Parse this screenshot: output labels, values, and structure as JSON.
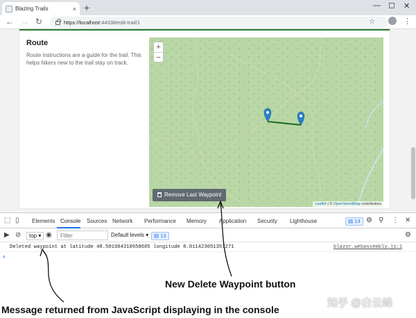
{
  "browser": {
    "tab_title": "Blazing Trails",
    "tab_close": "×",
    "new_tab": "+",
    "url_host": "https://localhost",
    "url_path": ":44338/edit-trail/1",
    "window_controls": {
      "minimize": "—",
      "maximize": "☐",
      "close": "✕"
    },
    "nav": {
      "back": "←",
      "forward": "→",
      "reload": "↻"
    }
  },
  "page": {
    "section_title": "Route",
    "section_description": "Route instructions are a guide for the trail. This helps hikers new to the trail stay on track.",
    "map": {
      "zoom_in": "+",
      "zoom_out": "−",
      "remove_button": "Remove Last Waypoint",
      "attribution_leaflet": "Leaflet",
      "attribution_sep": " | © ",
      "attribution_osm": "OpenStreetMap",
      "attribution_suffix": " contributors",
      "colors": {
        "map_bg": "#b9d7a6",
        "route_line": "#1b6b20",
        "marker": "#2a81cb",
        "button": "#606a70"
      },
      "icons": [
        "zoom-in-icon",
        "zoom-out-icon",
        "map-marker-icon",
        "trash-icon"
      ]
    }
  },
  "devtools": {
    "tabs": [
      "Elements",
      "Console",
      "Sources",
      "Network",
      "Performance",
      "Memory",
      "Application",
      "Security",
      "Lighthouse"
    ],
    "active_tab": "Console",
    "issues_count": "13",
    "context": "top",
    "filter_placeholder": "Filter",
    "default_levels": "Default levels",
    "messages_count": "13",
    "log_message": "Deleted waypoint at latitude 48.501604310658685 longitude 8.011423051357271",
    "log_source": "blazor.webassembly.js:1",
    "prompt": "›",
    "more": "⋮",
    "close": "✕"
  },
  "annotations": {
    "delete_button_caption": "New Delete Waypoint button",
    "console_caption": "Message returned from JavaScript displaying in the console"
  },
  "watermark": "知乎 @白云峰"
}
